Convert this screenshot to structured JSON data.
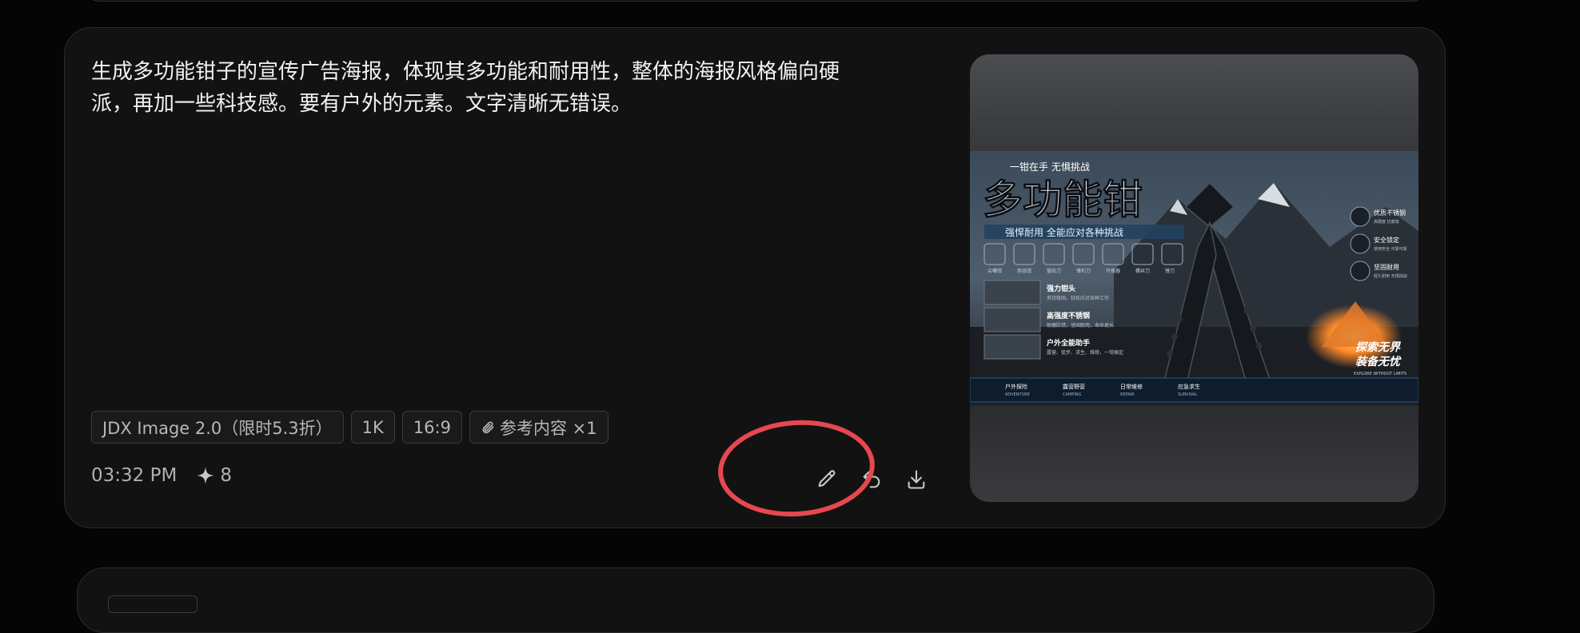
{
  "prompt": {
    "line1": "生成多功能钳子的宣传广告海报，体现其多功能和耐用性，整体的海报风格偏向硬",
    "line2": "派，再加一些科技感。要有户外的元素。文字清晰无错误。"
  },
  "tags": {
    "model": "JDX Image 2.0（限时5.3折）",
    "resolution": "1K",
    "ratio": "16:9",
    "reference": "参考内容 ×1"
  },
  "meta": {
    "time": "03:32 PM",
    "credits": "8"
  },
  "colors": {
    "highlight": "#e6484f",
    "card_bg": "#121213",
    "page_bg": "#050505"
  },
  "icons": {
    "reference": "paperclip-icon",
    "credits": "sparkle-icon",
    "edit": "pencil-icon",
    "redo": "undo-icon",
    "download": "download-icon"
  },
  "poster": {
    "slogan": "一钳在手  无惧挑战",
    "title": "多功能钳",
    "subtitle": "强悍耐用  全能应对各种挑战",
    "tools": [
      "尖嘴钳",
      "剪线钳",
      "锯齿刀",
      "锋利刀",
      "开瓶器",
      "螺丝刀",
      "锉刀"
    ],
    "features": [
      {
        "title": "强力钳头",
        "desc": "夹持稳固，轻松应对各种工作"
      },
      {
        "title": "高强度不锈钢",
        "desc": "耐磨防锈，坚固耐用，寿命更长"
      },
      {
        "title": "户外全能助手",
        "desc": "露营、徒步、求生、维修，一钳搞定"
      }
    ],
    "badges": [
      {
        "title": "优质不锈钢",
        "desc": "高硬度 抗腐蚀"
      },
      {
        "title": "安全锁定",
        "desc": "使用安全 可靠可靠"
      },
      {
        "title": "坚固耐用",
        "desc": "经久耐用 无惧挑战"
      }
    ],
    "explore": [
      "探索无界",
      "装备无忧"
    ],
    "explore_en": "EXPLORE WITHOUT LIMITS",
    "bottom": [
      {
        "cn": "户外探险",
        "en": "ADVENTURE"
      },
      {
        "cn": "露营野营",
        "en": "CAMPING"
      },
      {
        "cn": "日常维修",
        "en": "REPAIR"
      },
      {
        "cn": "应急求生",
        "en": "SURVIVAL"
      }
    ]
  }
}
